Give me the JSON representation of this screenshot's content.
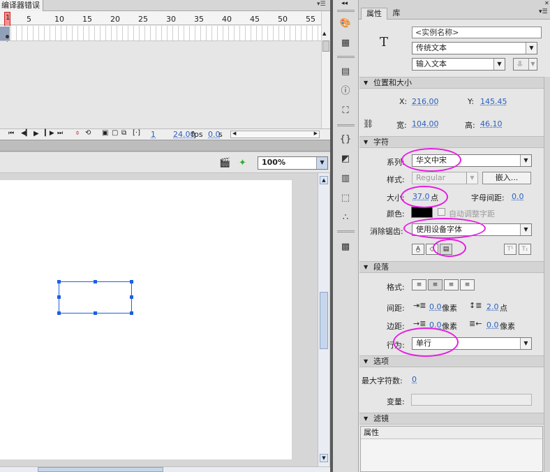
{
  "timeline": {
    "tab_label": "编译器错误",
    "frame_numbers": [
      "5",
      "10",
      "15",
      "20",
      "25",
      "30",
      "35",
      "40",
      "45",
      "50",
      "55"
    ],
    "current_frame_marker": "1",
    "status_frame": "1",
    "status_fps": "24.00",
    "status_fps_unit": "fps",
    "status_time": "0.0",
    "status_time_unit": "s"
  },
  "stage": {
    "zoom_value": "100%"
  },
  "properties": {
    "tab_properties": "属性",
    "tab_library": "库",
    "instance_name_placeholder": "<实例名称>",
    "text_engine": "传统文本",
    "text_type": "输入文本",
    "section_position": "位置和大小",
    "x_label": "X:",
    "x_value": "216.00",
    "y_label": "Y:",
    "y_value": "145.45",
    "width_label": "宽:",
    "width_value": "104.00",
    "height_label": "高:",
    "height_value": "46.10",
    "section_character": "字符",
    "family_label": "系列:",
    "family_value": "华文中宋",
    "style_label": "样式:",
    "style_value": "Regular",
    "embed_button": "嵌入...",
    "size_label": "大小:",
    "size_value": "37.0",
    "size_unit": "点",
    "letter_spacing_label": "字母间距:",
    "letter_spacing_value": "0.0",
    "color_label": "颜色:",
    "text_color": "#000000",
    "auto_kern_label": "自动调整字距",
    "antialias_label": "消除锯齿:",
    "antialias_value": "使用设备字体",
    "section_paragraph": "段落",
    "format_label": "格式:",
    "spacing_label": "间距:",
    "indent_value": "0.0",
    "pixel_unit": "像素",
    "line_spacing_value": "2.0",
    "point_unit": "点",
    "margin_label": "边距:",
    "left_margin_value": "0.0",
    "right_margin_value": "0.0",
    "behavior_label": "行为:",
    "behavior_value": "单行",
    "section_options": "选项",
    "max_chars_label": "最大字符数:",
    "max_chars_value": "0",
    "variable_label": "变量:",
    "section_filters": "滤镜",
    "filters_header": "属性"
  },
  "colors": {
    "highlight": "#e51ee0",
    "selection": "#1f5fe0",
    "playhead": "#e03030"
  }
}
